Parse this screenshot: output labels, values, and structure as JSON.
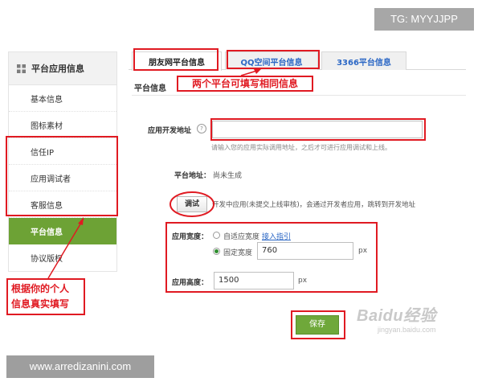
{
  "watermarks": {
    "tg": "TG: MYYJJPP",
    "site": "www.arredizanini.com",
    "baidu_logo": "Baidu经验",
    "baidu_url": "jingyan.baidu.com"
  },
  "sidebar": {
    "header": "平台应用信息",
    "items": [
      {
        "label": "基本信息"
      },
      {
        "label": "图标素材"
      },
      {
        "label": "信任IP"
      },
      {
        "label": "应用调试者"
      },
      {
        "label": "客服信息"
      },
      {
        "label": "平台信息",
        "active": true
      },
      {
        "label": "协议版权"
      }
    ]
  },
  "tabs": [
    {
      "label": "朋友网平台信息"
    },
    {
      "label": "QQ空间平台信息"
    },
    {
      "label": "3366平台信息"
    }
  ],
  "section_title": "平台信息",
  "form": {
    "dev_url": {
      "label": "应用开发地址",
      "help": "?",
      "value": "",
      "hint": "请输入您的应用实际调用地址，之后才可进行应用调试和上线。"
    },
    "platform_url": {
      "label": "平台地址：",
      "value": "尚未生成"
    },
    "debug": {
      "button": "调试",
      "hint": "开发中应用(未提交上线审核)，会通过开发者应用，跳转到开发地址"
    },
    "width": {
      "label": "应用宽度：",
      "option_adaptive": "自适应宽度",
      "option_adaptive_link": "接入指引",
      "option_fixed": "固定宽度",
      "value": "760",
      "unit": "px"
    },
    "height": {
      "label": "应用高度：",
      "value": "1500",
      "unit": "px"
    },
    "save_button": "保存"
  },
  "annotations": {
    "tabs_note": "两个平台可填写相同信息",
    "sidebar_note_line1": "根据你的个人",
    "sidebar_note_line2": "信息真实填写"
  },
  "colors": {
    "annotation_red": "#e01a22",
    "active_green": "#6da235",
    "link_blue": "#2b67c5"
  }
}
